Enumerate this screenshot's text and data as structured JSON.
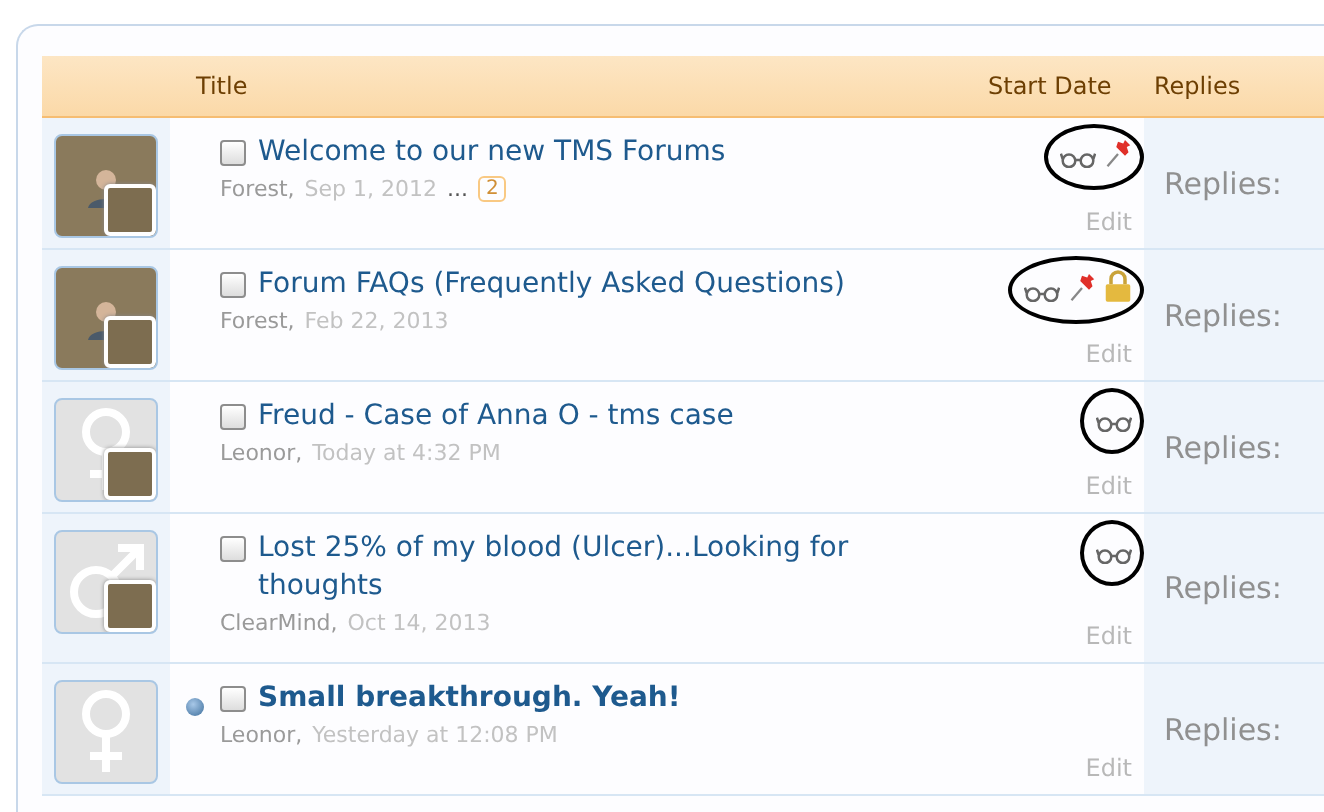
{
  "header": {
    "columns": [
      "Title",
      "Start Date",
      "Replies"
    ]
  },
  "threads": [
    {
      "avatar": {
        "kind": "photo"
      },
      "participant_avatar": true,
      "unread": false,
      "checked": false,
      "title": "Welcome to our new TMS Forums",
      "author": "Forest,",
      "date": "Sep 1, 2012",
      "pages": {
        "ellipsis": "...",
        "last": "2"
      },
      "watched": true,
      "sticky": true,
      "locked": false,
      "circled": true,
      "edit": "Edit",
      "replies": "Replies:"
    },
    {
      "avatar": {
        "kind": "photo"
      },
      "participant_avatar": true,
      "unread": false,
      "checked": false,
      "title": "Forum FAQs (Frequently Asked Questions)",
      "author": "Forest,",
      "date": "Feb 22, 2013",
      "watched": true,
      "sticky": true,
      "locked": true,
      "circled": true,
      "edit": "Edit",
      "replies": "Replies:"
    },
    {
      "avatar": {
        "kind": "female"
      },
      "participant_avatar": true,
      "unread": false,
      "checked": false,
      "title": "Freud - Case of Anna O - tms case",
      "author": "Leonor,",
      "date": "Today at 4:32 PM",
      "watched": true,
      "sticky": false,
      "locked": false,
      "circled": true,
      "edit": "Edit",
      "replies": "Replies:"
    },
    {
      "avatar": {
        "kind": "male"
      },
      "participant_avatar": true,
      "unread": false,
      "checked": false,
      "title": "Lost 25% of my blood (Ulcer)...Looking for thoughts",
      "author": "ClearMind,",
      "date": "Oct 14, 2013",
      "watched": true,
      "sticky": false,
      "locked": false,
      "circled": true,
      "edit": "Edit",
      "replies": "Replies:"
    },
    {
      "avatar": {
        "kind": "female"
      },
      "participant_avatar": false,
      "unread": true,
      "checked": false,
      "title": "Small breakthrough. Yeah!",
      "author": "Leonor,",
      "date": "Yesterday at 12:08 PM",
      "watched": false,
      "sticky": false,
      "locked": false,
      "circled": false,
      "edit": "Edit",
      "replies": "Replies:"
    }
  ]
}
